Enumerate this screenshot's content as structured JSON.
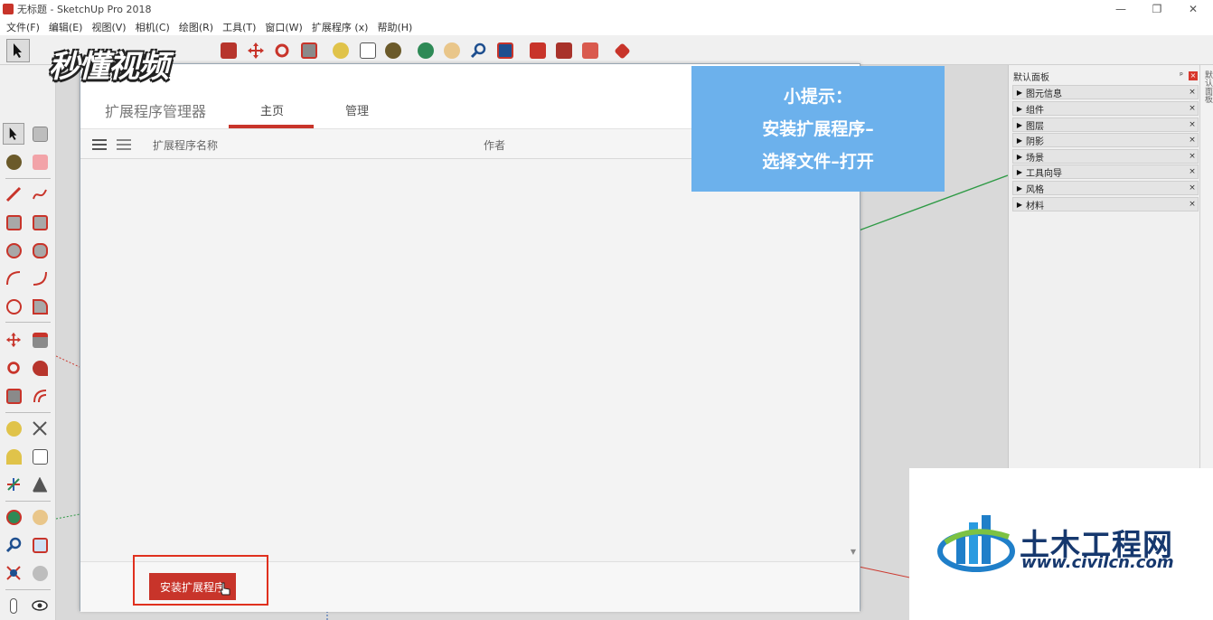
{
  "window": {
    "title": "无标题 - SketchUp Pro 2018",
    "controls": [
      "—",
      "❐",
      "✕"
    ]
  },
  "menu": [
    "文件(F)",
    "编辑(E)",
    "视图(V)",
    "相机(C)",
    "绘图(R)",
    "工具(T)",
    "窗口(W)",
    "扩展程序 (x)",
    "帮助(H)"
  ],
  "watermark": {
    "text": "秒懂视频"
  },
  "dialog": {
    "title": "扩展程序管理器",
    "tabs": [
      {
        "label": "主页",
        "active": true
      },
      {
        "label": "管理",
        "active": false
      }
    ],
    "columns": {
      "name": "扩展程序名称",
      "author": "作者"
    },
    "install_button": "安装扩展程序",
    "accent_color": "#c8342a"
  },
  "tip": {
    "line1": "小提示：",
    "line2": "安装扩展程序–",
    "line3": "选择文件–打开"
  },
  "tray": {
    "title": "默认面板",
    "pin": "ᵖ",
    "panels": [
      "图元信息",
      "组件",
      "图层",
      "阴影",
      "场景",
      "工具向导",
      "风格",
      "材料"
    ]
  },
  "side_strip": {
    "label": "默认面板"
  },
  "civil_logo": {
    "name": "土木工程网",
    "url": "www.civilcn.com"
  }
}
